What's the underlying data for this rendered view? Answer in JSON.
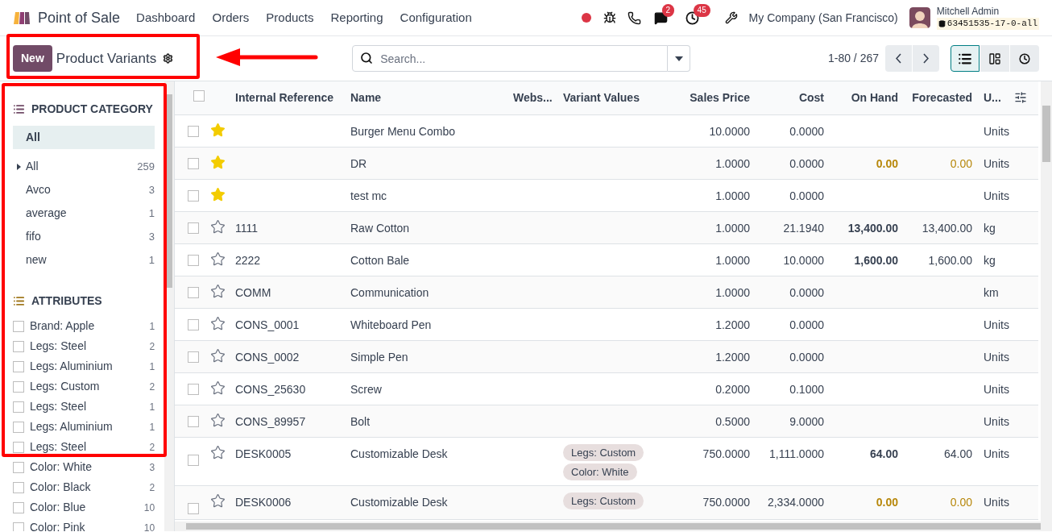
{
  "app": {
    "title": "Point of Sale"
  },
  "menu": [
    "Dashboard",
    "Orders",
    "Products",
    "Reporting",
    "Configuration"
  ],
  "systray": {
    "chat_count": "2",
    "activity_count": "45",
    "company": "My Company (San Francisco)",
    "user": "Mitchell Admin",
    "database": "63451535-17-0-all"
  },
  "control_panel": {
    "new_button": "New",
    "title": "Product Variants",
    "search_placeholder": "Search...",
    "pager": "1-80 / 267",
    "views": [
      {
        "kind": "list",
        "selected": true
      },
      {
        "kind": "kanban",
        "selected": false
      },
      {
        "kind": "activity",
        "selected": false
      }
    ]
  },
  "sidebar": {
    "category_title": "PRODUCT CATEGORY",
    "categories": [
      {
        "label": "All",
        "kind": "root",
        "selected": true
      },
      {
        "label": "All",
        "count": "259",
        "kind": "group",
        "selected": false
      },
      {
        "label": "Avco",
        "count": "3",
        "kind": "leaf",
        "selected": false
      },
      {
        "label": "average",
        "count": "1",
        "kind": "leaf",
        "selected": false
      },
      {
        "label": "fifo",
        "count": "3",
        "kind": "leaf",
        "selected": false
      },
      {
        "label": "new",
        "count": "1",
        "kind": "leaf",
        "selected": false
      }
    ],
    "attributes_title": "ATTRIBUTES",
    "attributes": [
      {
        "label": "Brand: Apple",
        "count": "1",
        "checked": false
      },
      {
        "label": "Legs: Steel",
        "count": "2",
        "checked": false
      },
      {
        "label": "Legs: Aluminium",
        "count": "1",
        "checked": false
      },
      {
        "label": "Legs: Custom",
        "count": "2",
        "checked": false
      },
      {
        "label": "Legs: Steel",
        "count": "1",
        "checked": false
      },
      {
        "label": "Legs: Aluminium",
        "count": "1",
        "checked": false
      },
      {
        "label": "Legs: Steel",
        "count": "2",
        "checked": false
      },
      {
        "label": "Color: White",
        "count": "3",
        "checked": false
      },
      {
        "label": "Color: Black",
        "count": "2",
        "checked": false
      },
      {
        "label": "Color: Blue",
        "count": "10",
        "checked": false
      },
      {
        "label": "Color: Pink",
        "count": "10",
        "checked": false
      }
    ]
  },
  "table": {
    "select_all": {
      "checked": false
    },
    "columns": [
      "Internal Reference",
      "Name",
      "Webs...",
      "Variant Values",
      "Sales Price",
      "Cost",
      "On Hand",
      "Forecasted",
      "U..."
    ],
    "rows": [
      {
        "selected": false,
        "favorite": true,
        "ref": "",
        "name": "Burger Menu Combo",
        "variants": [],
        "sales_price": "10.0000",
        "cost": "0.0000",
        "uom": "Units"
      },
      {
        "selected": false,
        "favorite": true,
        "ref": "",
        "name": "DR",
        "variants": [],
        "sales_price": "1.0000",
        "cost": "0.0000",
        "on_hand": "0.00",
        "forecasted": "0.00",
        "warning": true,
        "uom": "Units"
      },
      {
        "selected": false,
        "favorite": true,
        "ref": "",
        "name": "test mc",
        "variants": [],
        "sales_price": "1.0000",
        "cost": "0.0000",
        "uom": "Units"
      },
      {
        "selected": false,
        "favorite": false,
        "ref": "1111",
        "name": "Raw Cotton",
        "variants": [],
        "sales_price": "1.0000",
        "cost": "21.1940",
        "on_hand": "13,400.00",
        "forecasted": "13,400.00",
        "warning": false,
        "uom": "kg"
      },
      {
        "selected": false,
        "favorite": false,
        "ref": "2222",
        "name": "Cotton Bale",
        "variants": [],
        "sales_price": "1.0000",
        "cost": "10.0000",
        "on_hand": "1,600.00",
        "forecasted": "1,600.00",
        "warning": false,
        "uom": "kg"
      },
      {
        "selected": false,
        "favorite": false,
        "ref": "COMM",
        "name": "Communication",
        "variants": [],
        "sales_price": "1.0000",
        "cost": "0.0000",
        "uom": "km"
      },
      {
        "selected": false,
        "favorite": false,
        "ref": "CONS_0001",
        "name": "Whiteboard Pen",
        "variants": [],
        "sales_price": "1.2000",
        "cost": "0.0000",
        "uom": "Units"
      },
      {
        "selected": false,
        "favorite": false,
        "ref": "CONS_0002",
        "name": "Simple Pen",
        "variants": [],
        "sales_price": "1.2000",
        "cost": "0.0000",
        "uom": "Units"
      },
      {
        "selected": false,
        "favorite": false,
        "ref": "CONS_25630",
        "name": "Screw",
        "variants": [],
        "sales_price": "0.2000",
        "cost": "0.1000",
        "uom": "Units"
      },
      {
        "selected": false,
        "favorite": false,
        "ref": "CONS_89957",
        "name": "Bolt",
        "variants": [],
        "sales_price": "0.5000",
        "cost": "9.0000",
        "uom": "Units"
      },
      {
        "selected": false,
        "favorite": false,
        "ref": "DESK0005",
        "name": "Customizable Desk",
        "variants": [
          "Legs: Custom",
          "Color: White"
        ],
        "sales_price": "750.0000",
        "cost": "1,111.0000",
        "on_hand": "64.00",
        "forecasted": "64.00",
        "warning": false,
        "uom": "Units"
      },
      {
        "selected": false,
        "favorite": false,
        "ref": "DESK0006",
        "name": "Customizable Desk",
        "variants": [
          "Legs: Custom"
        ],
        "sales_price": "750.0000",
        "cost": "2,334.0000",
        "on_hand": "0.00",
        "forecasted": "0.00",
        "warning": true,
        "uom": "Units"
      }
    ]
  }
}
